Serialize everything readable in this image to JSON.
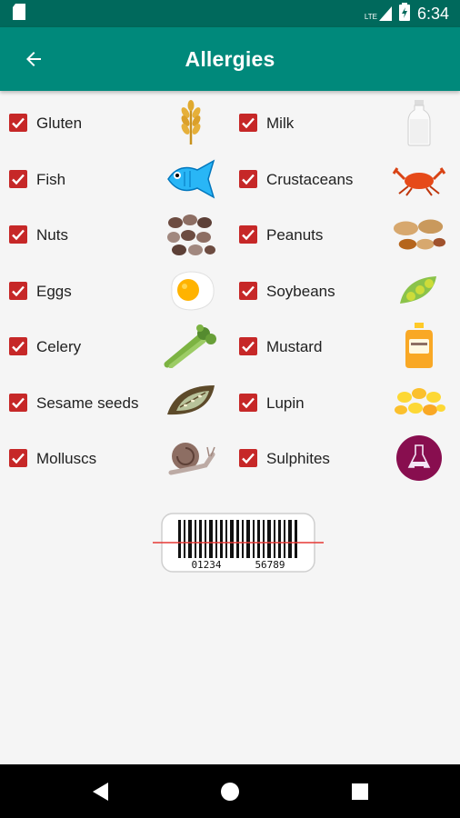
{
  "status": {
    "time": "6:34",
    "network": "LTE",
    "battery_label": "battery-charging-icon"
  },
  "header": {
    "title": "Allergies",
    "back_icon": "arrow-back-icon"
  },
  "colors": {
    "status_bar": "#00695c",
    "app_bar": "#00897b",
    "checkbox": "#c62828",
    "background": "#f5f5f5"
  },
  "allergens": {
    "left": [
      {
        "label": "Gluten",
        "checked": true,
        "icon": "wheat-icon"
      },
      {
        "label": "Fish",
        "checked": true,
        "icon": "fish-icon"
      },
      {
        "label": "Nuts",
        "checked": true,
        "icon": "nuts-icon"
      },
      {
        "label": "Eggs",
        "checked": true,
        "icon": "fried-egg-icon"
      },
      {
        "label": "Celery",
        "checked": true,
        "icon": "celery-icon"
      },
      {
        "label": "Sesame seeds",
        "checked": true,
        "icon": "sesame-pod-icon"
      },
      {
        "label": "Molluscs",
        "checked": true,
        "icon": "snail-icon"
      }
    ],
    "right": [
      {
        "label": "Milk",
        "checked": true,
        "icon": "milk-bottle-icon"
      },
      {
        "label": "Crustaceans",
        "checked": true,
        "icon": "crab-icon"
      },
      {
        "label": "Peanuts",
        "checked": true,
        "icon": "peanuts-icon"
      },
      {
        "label": "Soybeans",
        "checked": true,
        "icon": "soybean-pod-icon"
      },
      {
        "label": "Mustard",
        "checked": true,
        "icon": "mustard-bottle-icon"
      },
      {
        "label": "Lupin",
        "checked": true,
        "icon": "lupin-beans-icon"
      },
      {
        "label": "Sulphites",
        "checked": true,
        "icon": "flask-icon"
      }
    ]
  },
  "barcode": {
    "digits_left": "01234",
    "digits_right": "56789",
    "icon": "barcode-scan-icon"
  },
  "navigation": {
    "back": "nav-back-icon",
    "home": "nav-home-icon",
    "recents": "nav-recents-icon"
  }
}
